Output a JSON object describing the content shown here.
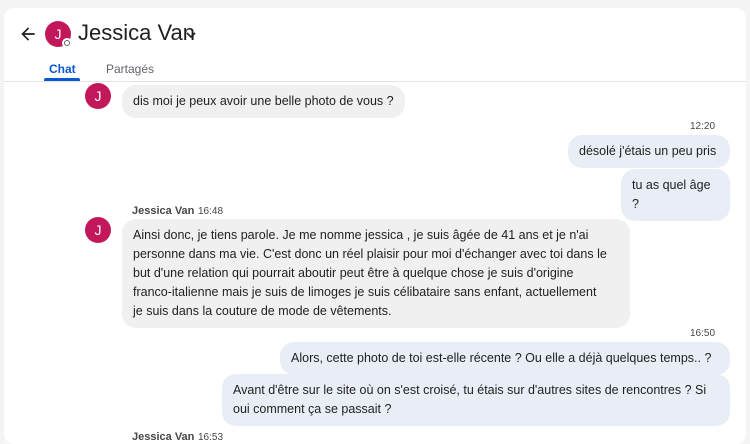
{
  "contact": {
    "name": "Jessica Van",
    "avatar_letter": "J",
    "avatar_color": "#c2185b"
  },
  "tabs": [
    {
      "label": "Chat",
      "active": true
    },
    {
      "label": "Partagés",
      "active": false
    }
  ],
  "messages": [
    {
      "direction": "in",
      "text": "dis moi je peux avoir une belle photo de vous ?"
    },
    {
      "direction": "out",
      "time": "12:20",
      "text": "désolé j'étais un peu pris"
    },
    {
      "direction": "out",
      "text": "tu as quel âge ?"
    },
    {
      "direction": "in",
      "sender": "Jessica Van",
      "time": "16:48",
      "lines": [
        "Ainsi donc, je tiens parole. Je me nomme jessica , je suis âgée de 41 ans et je n'ai",
        "personne dans ma vie. C'est donc un réel plaisir pour moi d'échanger avec toi dans le",
        "but d'une relation qui pourrait aboutir peut être à quelque chose je suis d'origine",
        "franco-italienne mais  je suis de limoges    je suis célibataire sans enfant, actuellement",
        "je suis dans la couture de  mode  de vêtements."
      ]
    },
    {
      "direction": "out",
      "time": "16:50",
      "text": "Alors, cette photo de toi est-elle récente ? Ou elle a déjà quelques temps.. ?"
    },
    {
      "direction": "out",
      "lines": [
        "Avant d'être sur le site où on s'est croisé,  tu étais sur d'autres sites de rencontres ? Si",
        "oui comment ça se passait ?"
      ]
    },
    {
      "direction": "in",
      "sender": "Jessica Van",
      "time": "16:53"
    }
  ],
  "colors": {
    "accent": "#0b57d0",
    "incoming_bubble": "#f0f0f0",
    "outgoing_bubble": "#e9eef6"
  },
  "icons": [
    "back-arrow-icon",
    "chevron-down-icon",
    "presence-icon"
  ]
}
